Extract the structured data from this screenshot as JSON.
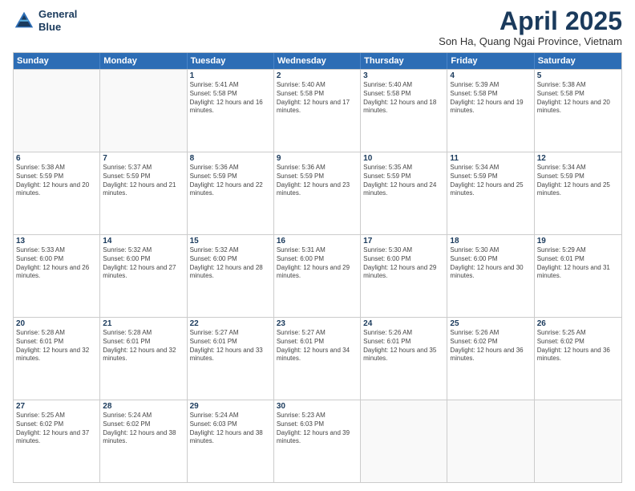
{
  "header": {
    "logo_line1": "General",
    "logo_line2": "Blue",
    "title": "April 2025",
    "subtitle": "Son Ha, Quang Ngai Province, Vietnam"
  },
  "weekdays": [
    "Sunday",
    "Monday",
    "Tuesday",
    "Wednesday",
    "Thursday",
    "Friday",
    "Saturday"
  ],
  "weeks": [
    [
      {
        "day": "",
        "sunrise": "",
        "sunset": "",
        "daylight": ""
      },
      {
        "day": "",
        "sunrise": "",
        "sunset": "",
        "daylight": ""
      },
      {
        "day": "1",
        "sunrise": "Sunrise: 5:41 AM",
        "sunset": "Sunset: 5:58 PM",
        "daylight": "Daylight: 12 hours and 16 minutes."
      },
      {
        "day": "2",
        "sunrise": "Sunrise: 5:40 AM",
        "sunset": "Sunset: 5:58 PM",
        "daylight": "Daylight: 12 hours and 17 minutes."
      },
      {
        "day": "3",
        "sunrise": "Sunrise: 5:40 AM",
        "sunset": "Sunset: 5:58 PM",
        "daylight": "Daylight: 12 hours and 18 minutes."
      },
      {
        "day": "4",
        "sunrise": "Sunrise: 5:39 AM",
        "sunset": "Sunset: 5:58 PM",
        "daylight": "Daylight: 12 hours and 19 minutes."
      },
      {
        "day": "5",
        "sunrise": "Sunrise: 5:38 AM",
        "sunset": "Sunset: 5:58 PM",
        "daylight": "Daylight: 12 hours and 20 minutes."
      }
    ],
    [
      {
        "day": "6",
        "sunrise": "Sunrise: 5:38 AM",
        "sunset": "Sunset: 5:59 PM",
        "daylight": "Daylight: 12 hours and 20 minutes."
      },
      {
        "day": "7",
        "sunrise": "Sunrise: 5:37 AM",
        "sunset": "Sunset: 5:59 PM",
        "daylight": "Daylight: 12 hours and 21 minutes."
      },
      {
        "day": "8",
        "sunrise": "Sunrise: 5:36 AM",
        "sunset": "Sunset: 5:59 PM",
        "daylight": "Daylight: 12 hours and 22 minutes."
      },
      {
        "day": "9",
        "sunrise": "Sunrise: 5:36 AM",
        "sunset": "Sunset: 5:59 PM",
        "daylight": "Daylight: 12 hours and 23 minutes."
      },
      {
        "day": "10",
        "sunrise": "Sunrise: 5:35 AM",
        "sunset": "Sunset: 5:59 PM",
        "daylight": "Daylight: 12 hours and 24 minutes."
      },
      {
        "day": "11",
        "sunrise": "Sunrise: 5:34 AM",
        "sunset": "Sunset: 5:59 PM",
        "daylight": "Daylight: 12 hours and 25 minutes."
      },
      {
        "day": "12",
        "sunrise": "Sunrise: 5:34 AM",
        "sunset": "Sunset: 5:59 PM",
        "daylight": "Daylight: 12 hours and 25 minutes."
      }
    ],
    [
      {
        "day": "13",
        "sunrise": "Sunrise: 5:33 AM",
        "sunset": "Sunset: 6:00 PM",
        "daylight": "Daylight: 12 hours and 26 minutes."
      },
      {
        "day": "14",
        "sunrise": "Sunrise: 5:32 AM",
        "sunset": "Sunset: 6:00 PM",
        "daylight": "Daylight: 12 hours and 27 minutes."
      },
      {
        "day": "15",
        "sunrise": "Sunrise: 5:32 AM",
        "sunset": "Sunset: 6:00 PM",
        "daylight": "Daylight: 12 hours and 28 minutes."
      },
      {
        "day": "16",
        "sunrise": "Sunrise: 5:31 AM",
        "sunset": "Sunset: 6:00 PM",
        "daylight": "Daylight: 12 hours and 29 minutes."
      },
      {
        "day": "17",
        "sunrise": "Sunrise: 5:30 AM",
        "sunset": "Sunset: 6:00 PM",
        "daylight": "Daylight: 12 hours and 29 minutes."
      },
      {
        "day": "18",
        "sunrise": "Sunrise: 5:30 AM",
        "sunset": "Sunset: 6:00 PM",
        "daylight": "Daylight: 12 hours and 30 minutes."
      },
      {
        "day": "19",
        "sunrise": "Sunrise: 5:29 AM",
        "sunset": "Sunset: 6:01 PM",
        "daylight": "Daylight: 12 hours and 31 minutes."
      }
    ],
    [
      {
        "day": "20",
        "sunrise": "Sunrise: 5:28 AM",
        "sunset": "Sunset: 6:01 PM",
        "daylight": "Daylight: 12 hours and 32 minutes."
      },
      {
        "day": "21",
        "sunrise": "Sunrise: 5:28 AM",
        "sunset": "Sunset: 6:01 PM",
        "daylight": "Daylight: 12 hours and 32 minutes."
      },
      {
        "day": "22",
        "sunrise": "Sunrise: 5:27 AM",
        "sunset": "Sunset: 6:01 PM",
        "daylight": "Daylight: 12 hours and 33 minutes."
      },
      {
        "day": "23",
        "sunrise": "Sunrise: 5:27 AM",
        "sunset": "Sunset: 6:01 PM",
        "daylight": "Daylight: 12 hours and 34 minutes."
      },
      {
        "day": "24",
        "sunrise": "Sunrise: 5:26 AM",
        "sunset": "Sunset: 6:01 PM",
        "daylight": "Daylight: 12 hours and 35 minutes."
      },
      {
        "day": "25",
        "sunrise": "Sunrise: 5:26 AM",
        "sunset": "Sunset: 6:02 PM",
        "daylight": "Daylight: 12 hours and 36 minutes."
      },
      {
        "day": "26",
        "sunrise": "Sunrise: 5:25 AM",
        "sunset": "Sunset: 6:02 PM",
        "daylight": "Daylight: 12 hours and 36 minutes."
      }
    ],
    [
      {
        "day": "27",
        "sunrise": "Sunrise: 5:25 AM",
        "sunset": "Sunset: 6:02 PM",
        "daylight": "Daylight: 12 hours and 37 minutes."
      },
      {
        "day": "28",
        "sunrise": "Sunrise: 5:24 AM",
        "sunset": "Sunset: 6:02 PM",
        "daylight": "Daylight: 12 hours and 38 minutes."
      },
      {
        "day": "29",
        "sunrise": "Sunrise: 5:24 AM",
        "sunset": "Sunset: 6:03 PM",
        "daylight": "Daylight: 12 hours and 38 minutes."
      },
      {
        "day": "30",
        "sunrise": "Sunrise: 5:23 AM",
        "sunset": "Sunset: 6:03 PM",
        "daylight": "Daylight: 12 hours and 39 minutes."
      },
      {
        "day": "",
        "sunrise": "",
        "sunset": "",
        "daylight": ""
      },
      {
        "day": "",
        "sunrise": "",
        "sunset": "",
        "daylight": ""
      },
      {
        "day": "",
        "sunrise": "",
        "sunset": "",
        "daylight": ""
      }
    ]
  ]
}
